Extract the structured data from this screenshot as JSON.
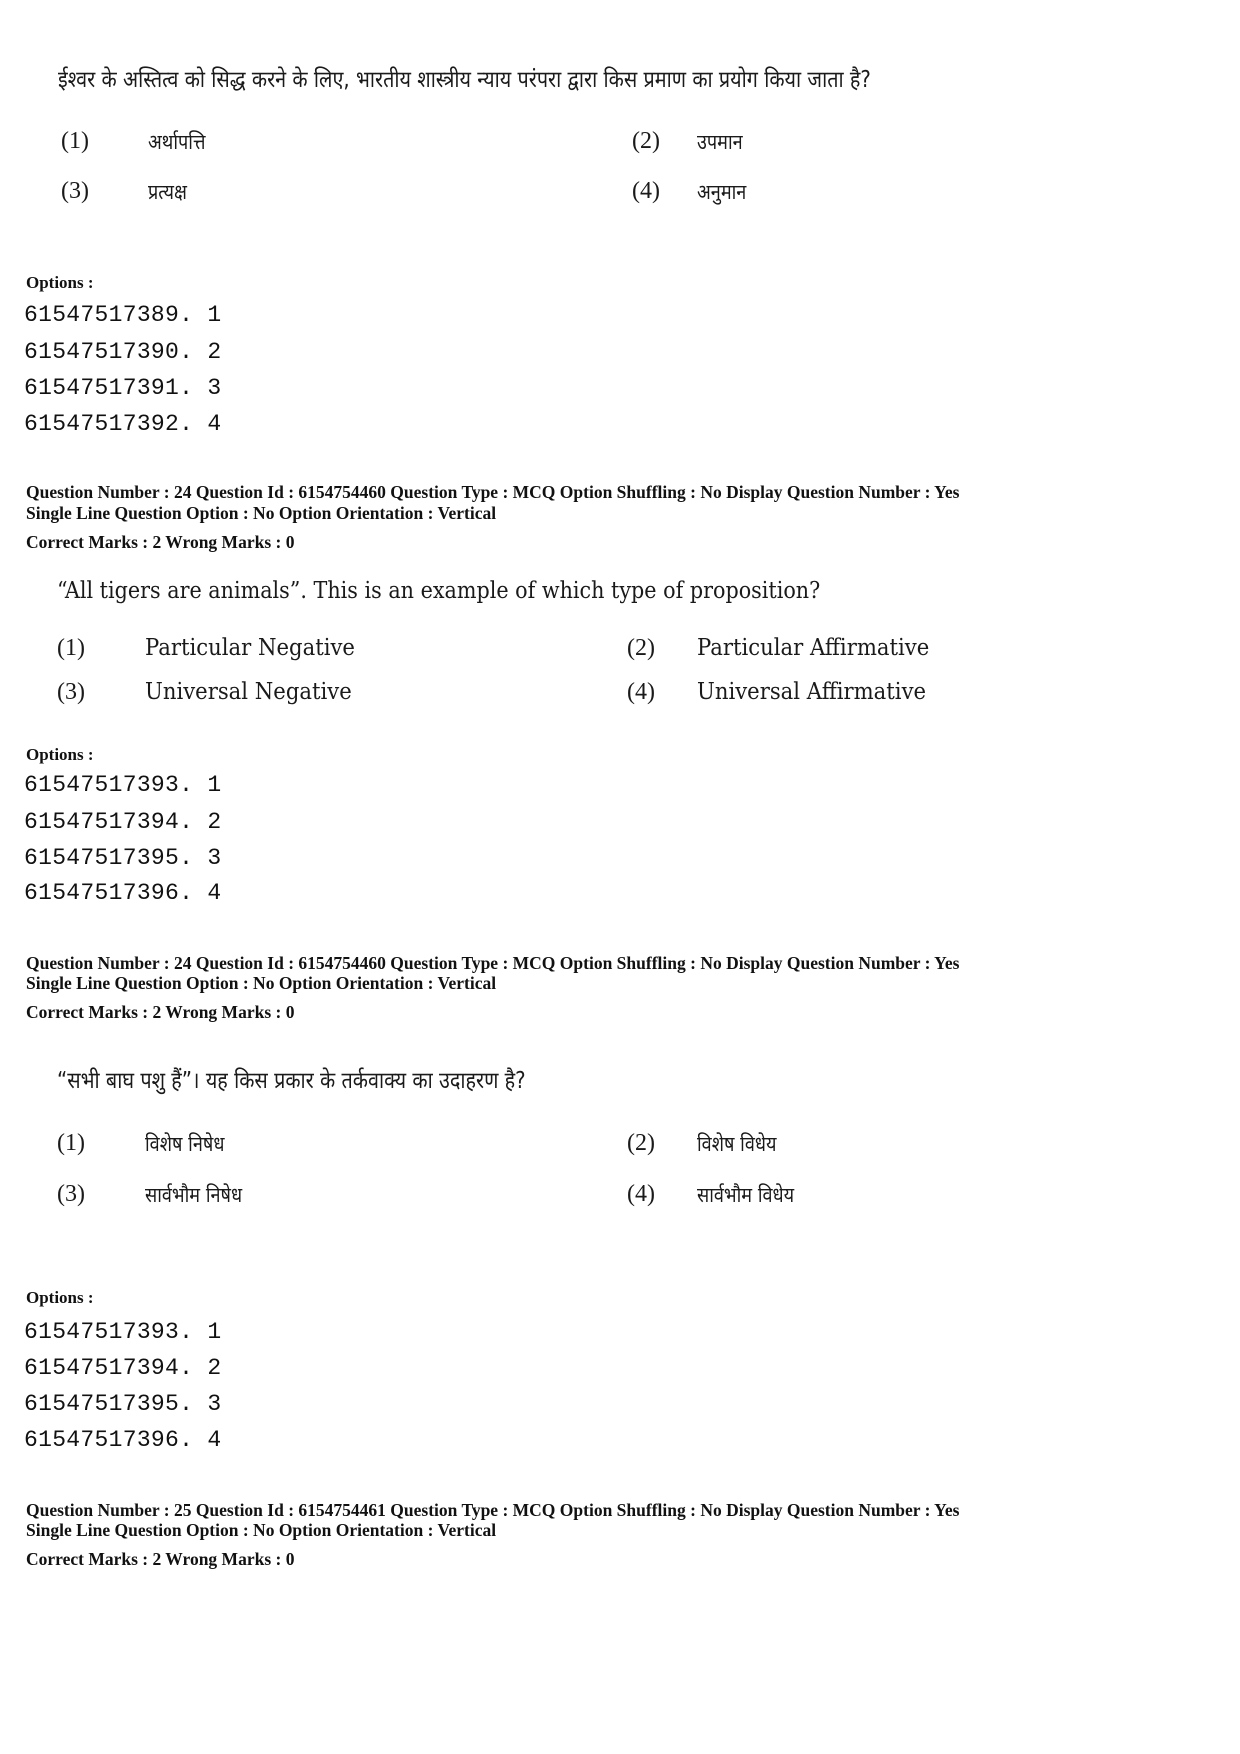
{
  "blocks": [
    {
      "question": "ईश्वर के अस्तित्व को सिद्ध करने के लिए, भारतीय शास्त्रीय न्याय परंपरा द्वारा किस प्रमाण का प्रयोग किया जाता है?",
      "choices": [
        {
          "num": "(1)",
          "text": "अर्थापत्ति"
        },
        {
          "num": "(2)",
          "text": "उपमान"
        },
        {
          "num": "(3)",
          "text": "प्रत्यक्ष"
        },
        {
          "num": "(4)",
          "text": "अनुमान"
        }
      ],
      "options_label": "Options :",
      "options": [
        "61547517389. 1",
        "61547517390. 2",
        "61547517391. 3",
        "61547517392. 4"
      ]
    },
    {
      "meta_line1": "Question Number : 24  Question Id : 6154754460  Question Type : MCQ  Option Shuffling : No  Display Question Number : Yes",
      "meta_line2": "Single Line Question Option : No  Option Orientation : Vertical",
      "marks": "Correct Marks : 2  Wrong Marks : 0",
      "question": "“All tigers are animals”. This is an example of which type of proposition?",
      "choices": [
        {
          "num": "(1)",
          "text": "Particular Negative"
        },
        {
          "num": "(2)",
          "text": "Particular Affirmative"
        },
        {
          "num": "(3)",
          "text": "Universal Negative"
        },
        {
          "num": "(4)",
          "text": "Universal Affirmative"
        }
      ],
      "options_label": "Options :",
      "options": [
        "61547517393. 1",
        "61547517394. 2",
        "61547517395. 3",
        "61547517396. 4"
      ]
    },
    {
      "meta_line1": "Question Number : 24  Question Id : 6154754460  Question Type : MCQ  Option Shuffling : No  Display Question Number : Yes",
      "meta_line2": "Single Line Question Option : No  Option Orientation : Vertical",
      "marks": "Correct Marks : 2  Wrong Marks : 0",
      "question": "“सभी बाघ पशु हैं”। यह किस प्रकार के तर्कवाक्य का उदाहरण है?",
      "choices": [
        {
          "num": "(1)",
          "text": "विशेष निषेध"
        },
        {
          "num": "(2)",
          "text": "विशेष विधेय"
        },
        {
          "num": "(3)",
          "text": "सार्वभौम निषेध"
        },
        {
          "num": "(4)",
          "text": "सार्वभौम विधेय"
        }
      ],
      "options_label": "Options :",
      "options": [
        "61547517393. 1",
        "61547517394. 2",
        "61547517395. 3",
        "61547517396. 4"
      ]
    },
    {
      "meta_line1": "Question Number : 25  Question Id : 6154754461  Question Type : MCQ  Option Shuffling : No  Display Question Number : Yes",
      "meta_line2": "Single Line Question Option : No  Option Orientation : Vertical",
      "marks": "Correct Marks : 2  Wrong Marks : 0"
    }
  ]
}
